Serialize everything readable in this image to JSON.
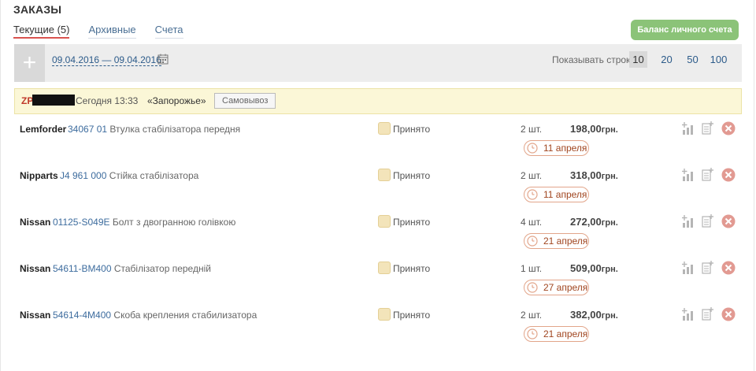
{
  "page": {
    "title": "ЗАКАЗЫ"
  },
  "tabs": [
    {
      "label": "Текущие (5)",
      "active": true
    },
    {
      "label": "Архивные",
      "active": false
    },
    {
      "label": "Счета",
      "active": false
    }
  ],
  "balance_button": "Баланс личного счета",
  "toolbar": {
    "date_range": "09.04.2016 — 09.04.2016",
    "rows_label": "Показывать строк:",
    "rows_options": [
      "10",
      "20",
      "50",
      "100"
    ],
    "rows_selected": "10"
  },
  "order": {
    "id_prefix": "ZP",
    "time": "Сегодня 13:33",
    "store": "«Запорожье»",
    "delivery": "Самовывоз"
  },
  "items": [
    {
      "brand": "Lemforder",
      "code": "34067 01",
      "name": "Втулка стабілізатора передня",
      "status": "Принято",
      "qty": "2 шт.",
      "price": "198,00",
      "currency": "грн.",
      "date": "11 апреля"
    },
    {
      "brand": "Nipparts",
      "code": "J4 961 000",
      "name": "Стійка стабілізатора",
      "status": "Принято",
      "qty": "2 шт.",
      "price": "318,00",
      "currency": "грн.",
      "date": "11 апреля"
    },
    {
      "brand": "Nissan",
      "code": "01125-S049E",
      "name": "Болт з двогранною голівкою",
      "status": "Принято",
      "qty": "4 шт.",
      "price": "272,00",
      "currency": "грн.",
      "date": "21 апреля"
    },
    {
      "brand": "Nissan",
      "code": "54611-BM400",
      "name": "Стабілізатор передній",
      "status": "Принято",
      "qty": "1 шт.",
      "price": "509,00",
      "currency": "грн.",
      "date": "27 апреля"
    },
    {
      "brand": "Nissan",
      "code": "54614-4M400",
      "name": "Скоба крепления стабилизатора",
      "status": "Принято",
      "qty": "2 шт.",
      "price": "382,00",
      "currency": "грн.",
      "date": "21 апреля"
    }
  ],
  "colors": {
    "accent_green": "#8bc378",
    "link_blue": "#2c5b8a",
    "danger_red": "#d9534f",
    "order_bg": "#fbf7d7"
  }
}
